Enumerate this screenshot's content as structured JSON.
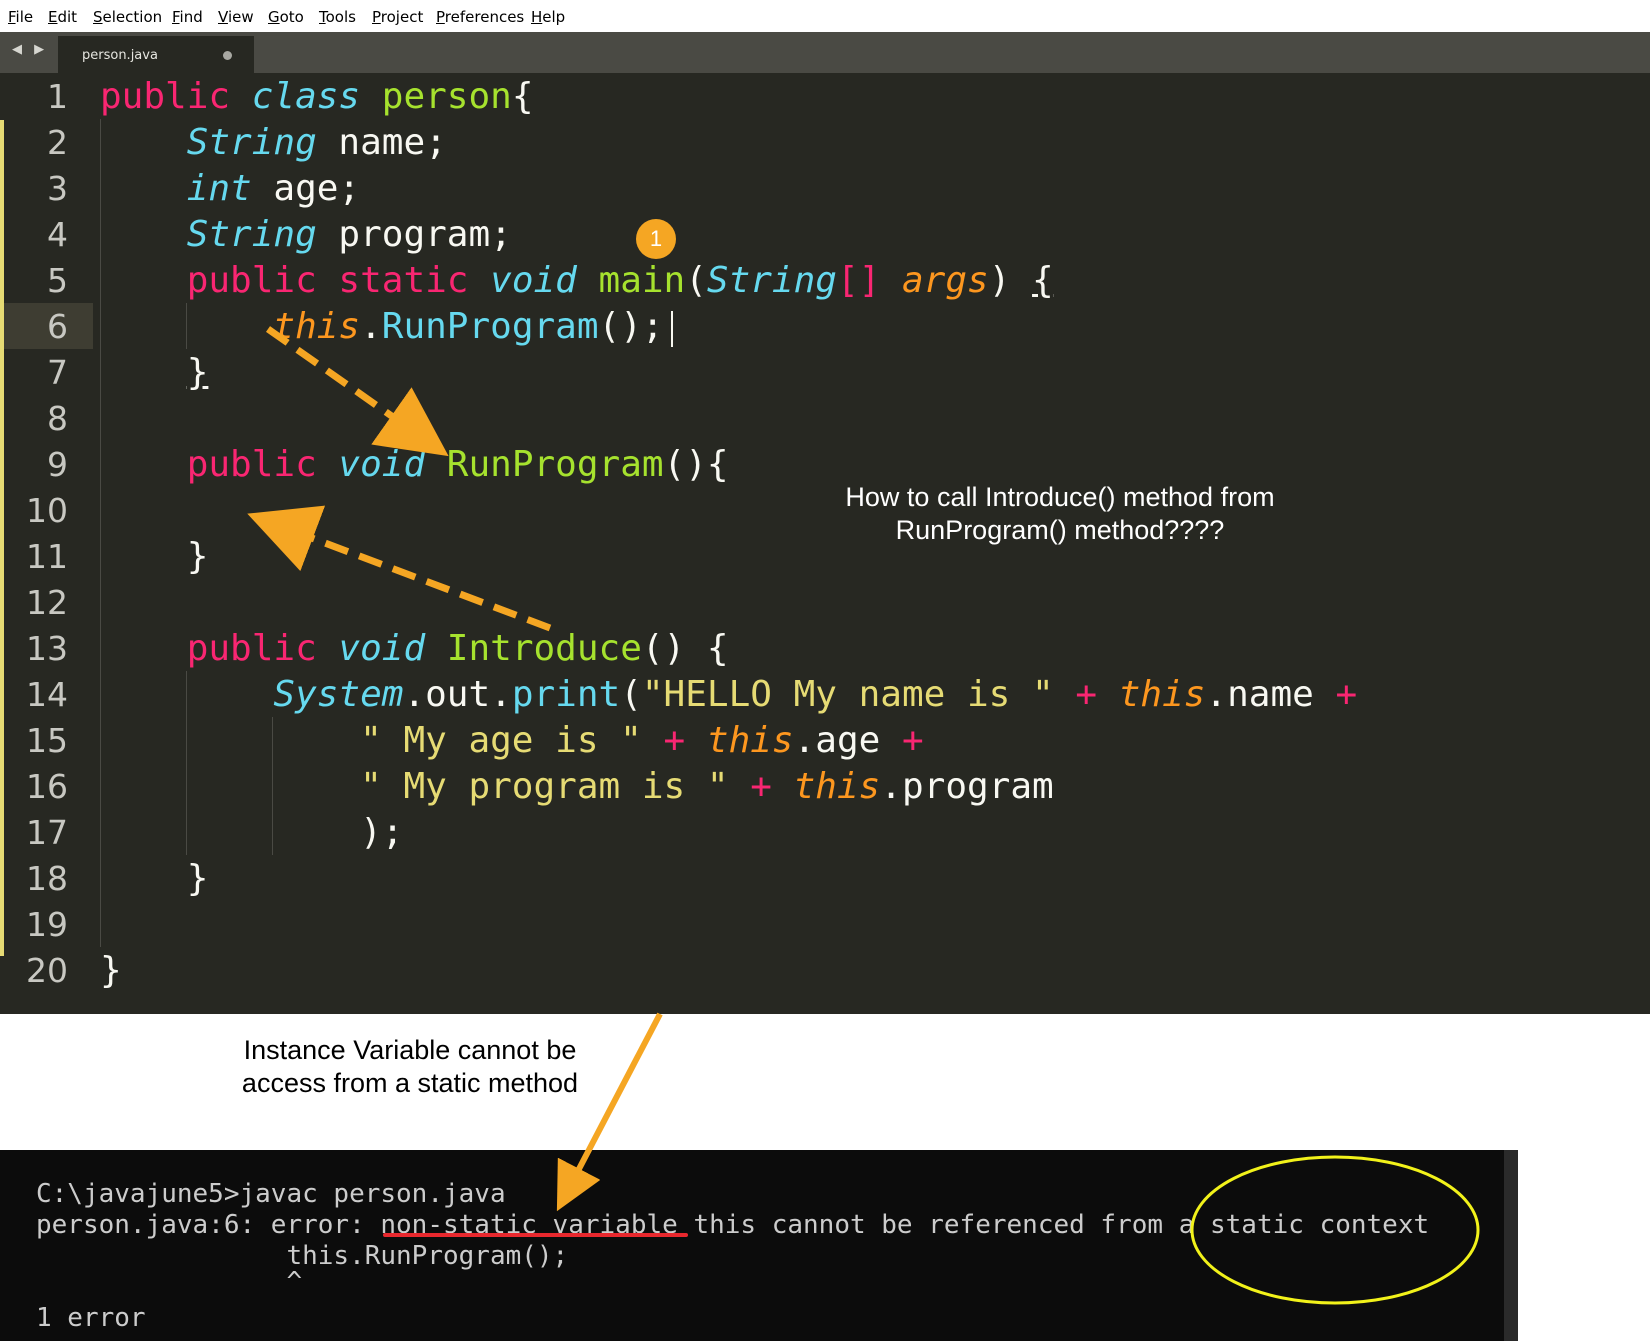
{
  "menu": [
    "File",
    "Edit",
    "Selection",
    "Find",
    "View",
    "Goto",
    "Tools",
    "Project",
    "Preferences",
    "Help"
  ],
  "tabbar": {
    "nav_arrows": "◀ ▶",
    "tab_title": "person.java"
  },
  "editor": {
    "line_numbers": [
      "1",
      "2",
      "3",
      "4",
      "5",
      "6",
      "7",
      "8",
      "9",
      "10",
      "11",
      "12",
      "13",
      "14",
      "15",
      "16",
      "17",
      "18",
      "19",
      "20"
    ],
    "code": [
      [
        [
          "kw",
          "public "
        ],
        [
          "tp",
          "class "
        ],
        [
          "fn",
          "person"
        ],
        [
          "pl",
          "{"
        ]
      ],
      [
        [
          "pl",
          "    "
        ],
        [
          "tp",
          "String "
        ],
        [
          "pl",
          "name;"
        ]
      ],
      [
        [
          "pl",
          "    "
        ],
        [
          "tp",
          "int "
        ],
        [
          "pl",
          "age;"
        ]
      ],
      [
        [
          "pl",
          "    "
        ],
        [
          "tp",
          "String "
        ],
        [
          "pl",
          "program;"
        ]
      ],
      [
        [
          "pl",
          "    "
        ],
        [
          "kw",
          "public static "
        ],
        [
          "tp",
          "void "
        ],
        [
          "fn",
          "main"
        ],
        [
          "pl",
          "("
        ],
        [
          "tp",
          "String"
        ],
        [
          "kw",
          "[] "
        ],
        [
          "ar",
          "args"
        ],
        [
          "pl",
          ") "
        ],
        [
          "ul",
          "{"
        ]
      ],
      [
        [
          "pl",
          "        "
        ],
        [
          "ar",
          "this"
        ],
        [
          "pl",
          "."
        ],
        [
          "mt",
          "RunProgram"
        ],
        [
          "pl",
          "();"
        ]
      ],
      [
        [
          "pl",
          "    "
        ],
        [
          "ul",
          "}"
        ]
      ],
      [
        [
          "pl",
          ""
        ]
      ],
      [
        [
          "pl",
          "    "
        ],
        [
          "kw",
          "public "
        ],
        [
          "tp",
          "void "
        ],
        [
          "fn",
          "RunProgram"
        ],
        [
          "pl",
          "(){"
        ]
      ],
      [
        [
          "pl",
          ""
        ]
      ],
      [
        [
          "pl",
          "    }"
        ]
      ],
      [
        [
          "pl",
          ""
        ]
      ],
      [
        [
          "pl",
          "    "
        ],
        [
          "kw",
          "public "
        ],
        [
          "tp",
          "void "
        ],
        [
          "fn",
          "Introduce"
        ],
        [
          "pl",
          "() {"
        ]
      ],
      [
        [
          "pl",
          "        "
        ],
        [
          "tp",
          "System"
        ],
        [
          "pl",
          ".out."
        ],
        [
          "mt",
          "print"
        ],
        [
          "pl",
          "("
        ],
        [
          "st",
          "\"HELLO My name is \" "
        ],
        [
          "kw",
          "+ "
        ],
        [
          "ar",
          "this"
        ],
        [
          "pl",
          ".name "
        ],
        [
          "kw",
          "+"
        ]
      ],
      [
        [
          "pl",
          "            "
        ],
        [
          "st",
          "\" My age is \" "
        ],
        [
          "kw",
          "+ "
        ],
        [
          "ar",
          "this"
        ],
        [
          "pl",
          ".age "
        ],
        [
          "kw",
          "+"
        ]
      ],
      [
        [
          "pl",
          "            "
        ],
        [
          "st",
          "\" My program is \" "
        ],
        [
          "kw",
          "+ "
        ],
        [
          "ar",
          "this"
        ],
        [
          "pl",
          ".program"
        ]
      ],
      [
        [
          "pl",
          "            );"
        ]
      ],
      [
        [
          "pl",
          "    }"
        ]
      ],
      [
        [
          "pl",
          ""
        ]
      ],
      [
        [
          "pl",
          "}"
        ]
      ]
    ],
    "badge": "1",
    "question": "How to call Introduce() method from RunProgram() method????"
  },
  "note": "Instance Variable cannot be access from a static method",
  "console": {
    "lines": [
      "C:\\javajune5>javac person.java",
      "person.java:6: error: non-static variable this cannot be referenced from a static context",
      "                this.RunProgram();",
      "                ^",
      "1 error"
    ]
  },
  "colors": {
    "editor_bg": "#272822",
    "keyword": "#f92672",
    "type": "#66d9ef",
    "function": "#a6e22e",
    "argument": "#fd971f",
    "string": "#e6db74",
    "arrow": "#f5a623",
    "underline": "#e8282e",
    "ellipse": "#f2f21a"
  }
}
